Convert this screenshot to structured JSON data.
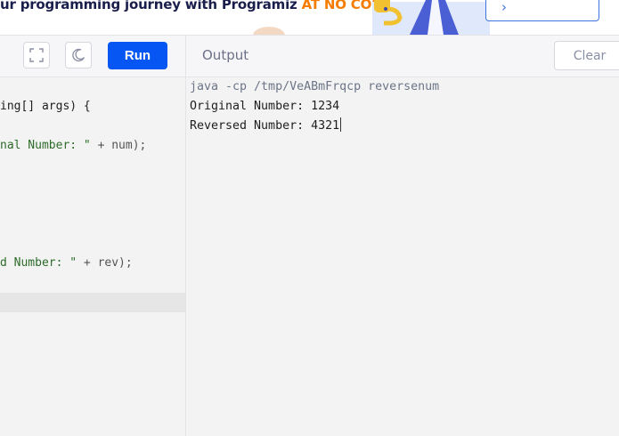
{
  "banner": {
    "text_prefix": "ur programming journey with Programiz ",
    "text_accent": "AT NO COST",
    "text_suffix": ".",
    "cta_label": "›",
    "accent_color": "#f57c00"
  },
  "editor": {
    "fullscreen_icon": "fullscreen-icon",
    "theme_icon": "moon-icon",
    "run_label": "Run",
    "run_color": "#0556f3",
    "code_lines": [
      {
        "plain": "ing[] args) {",
        "str": "",
        "rest": ""
      },
      {
        "plain": "",
        "str": "nal Number: \"",
        "rest": " + num);"
      },
      {
        "plain": "",
        "str": "d Number: \"",
        "rest": " + rev);"
      }
    ]
  },
  "output": {
    "title": "Output",
    "clear_label": "Clear",
    "lines": [
      "java -cp /tmp/VeABmFrqcp reversenum",
      "Original Number: 1234",
      "Reversed Number: 4321"
    ]
  }
}
